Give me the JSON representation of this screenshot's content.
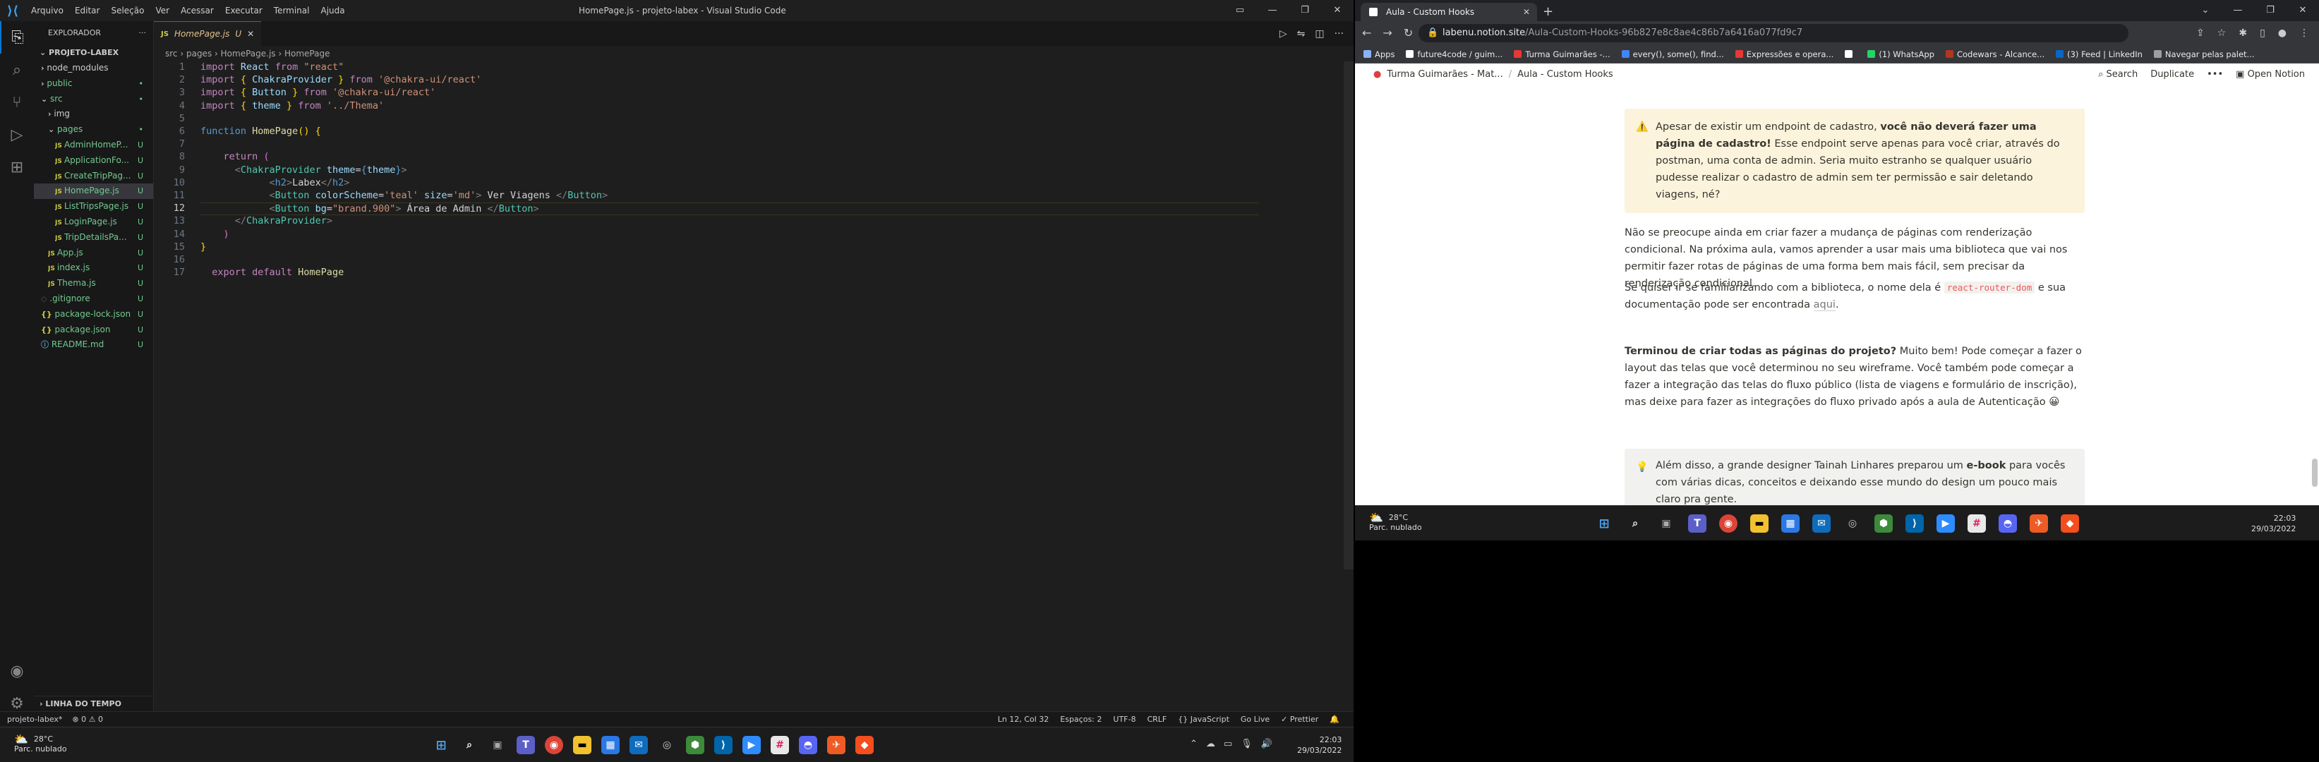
{
  "vscode": {
    "window_title": "HomePage.js - projeto-labex - Visual Studio Code",
    "menu": [
      "Arquivo",
      "Editar",
      "Seleção",
      "Ver",
      "Acessar",
      "Executar",
      "Terminal",
      "Ajuda"
    ],
    "explorer_title": "EXPLORADOR",
    "project": "PROJETO-LABEX",
    "tree": [
      {
        "name": "node_modules",
        "indent": 1,
        "kind": "folder",
        "badge": "",
        "color": "#cccccc"
      },
      {
        "name": "public",
        "indent": 1,
        "kind": "folder",
        "badge": "•",
        "color": "#73c991"
      },
      {
        "name": "src",
        "indent": 1,
        "kind": "folder-open",
        "badge": "•",
        "color": "#73c991"
      },
      {
        "name": "img",
        "indent": 2,
        "kind": "folder",
        "badge": "",
        "color": "#cccccc"
      },
      {
        "name": "pages",
        "indent": 2,
        "kind": "folder-open",
        "badge": "•",
        "color": "#73c991"
      },
      {
        "name": "AdminHomeP...",
        "indent": 3,
        "kind": "js",
        "badge": "U",
        "color": "#73c991"
      },
      {
        "name": "ApplicationFo...",
        "indent": 3,
        "kind": "js",
        "badge": "U",
        "color": "#73c991"
      },
      {
        "name": "CreateTripPag...",
        "indent": 3,
        "kind": "js",
        "badge": "U",
        "color": "#73c991"
      },
      {
        "name": "HomePage.js",
        "indent": 3,
        "kind": "js",
        "badge": "U",
        "color": "#73c991",
        "selected": true
      },
      {
        "name": "ListTripsPage.js",
        "indent": 3,
        "kind": "js",
        "badge": "U",
        "color": "#73c991"
      },
      {
        "name": "LoginPage.js",
        "indent": 3,
        "kind": "js",
        "badge": "U",
        "color": "#73c991"
      },
      {
        "name": "TripDetailsPa...",
        "indent": 3,
        "kind": "js",
        "badge": "U",
        "color": "#73c991"
      },
      {
        "name": "App.js",
        "indent": 2,
        "kind": "js",
        "badge": "U",
        "color": "#73c991"
      },
      {
        "name": "index.js",
        "indent": 2,
        "kind": "js",
        "badge": "U",
        "color": "#73c991"
      },
      {
        "name": "Thema.js",
        "indent": 2,
        "kind": "js",
        "badge": "U",
        "color": "#73c991"
      },
      {
        "name": ".gitignore",
        "indent": 1,
        "kind": "git",
        "badge": "U",
        "color": "#73c991"
      },
      {
        "name": "package-lock.json",
        "indent": 1,
        "kind": "json",
        "badge": "U",
        "color": "#73c991"
      },
      {
        "name": "package.json",
        "indent": 1,
        "kind": "json",
        "badge": "U",
        "color": "#73c991"
      },
      {
        "name": "README.md",
        "indent": 1,
        "kind": "md",
        "badge": "U",
        "color": "#73c991"
      }
    ],
    "timeline": "LINHA DO TEMPO",
    "tab_label": "HomePage.js",
    "tab_status": "U",
    "breadcrumb": [
      "src",
      "pages",
      "HomePage.js",
      "HomePage"
    ],
    "code_lines": [
      [
        [
          "kw",
          "import "
        ],
        [
          "vr",
          "React "
        ],
        [
          "kw",
          "from "
        ],
        [
          "str",
          "\"react\""
        ]
      ],
      [
        [
          "kw",
          "import "
        ],
        [
          "br",
          "{ "
        ],
        [
          "vr",
          "ChakraProvider "
        ],
        [
          "br",
          "} "
        ],
        [
          "kw",
          "from "
        ],
        [
          "str",
          "'@chakra-ui/react'"
        ]
      ],
      [
        [
          "kw",
          "import "
        ],
        [
          "br",
          "{ "
        ],
        [
          "vr",
          "Button "
        ],
        [
          "br",
          "} "
        ],
        [
          "kw",
          "from "
        ],
        [
          "str",
          "'@chakra-ui/react'"
        ]
      ],
      [
        [
          "kw",
          "import "
        ],
        [
          "br",
          "{ "
        ],
        [
          "vr",
          "theme "
        ],
        [
          "br",
          "} "
        ],
        [
          "kw",
          "from "
        ],
        [
          "str",
          "'../Thema'"
        ]
      ],
      [],
      [
        [
          "kw2",
          "function "
        ],
        [
          "fn",
          "HomePage"
        ],
        [
          "br",
          "() {"
        ]
      ],
      [],
      [
        [
          "kw",
          "    return "
        ],
        [
          "br2",
          "("
        ]
      ],
      [
        [
          "gr",
          "      <"
        ],
        [
          "tg",
          "ChakraProvider "
        ],
        [
          "vr",
          "theme"
        ],
        [
          "txt",
          "="
        ],
        [
          "kw2",
          "{"
        ],
        [
          "vr",
          "theme"
        ],
        [
          "kw2",
          "}"
        ],
        [
          "gr",
          ">"
        ]
      ],
      [
        [
          "gr",
          "            <"
        ],
        [
          "kw2",
          "h2"
        ],
        [
          "gr",
          ">"
        ],
        [
          "txt",
          "Labex"
        ],
        [
          "gr",
          "</"
        ],
        [
          "kw2",
          "h2"
        ],
        [
          "gr",
          ">"
        ]
      ],
      [
        [
          "gr",
          "            <"
        ],
        [
          "tg",
          "Button "
        ],
        [
          "vr",
          "colorScheme"
        ],
        [
          "txt",
          "="
        ],
        [
          "str",
          "'teal' "
        ],
        [
          "vr",
          "size"
        ],
        [
          "txt",
          "="
        ],
        [
          "str",
          "'md'"
        ],
        [
          "gr",
          "> "
        ],
        [
          "txt",
          "Ver Viagens "
        ],
        [
          "gr",
          "</"
        ],
        [
          "tg",
          "Button"
        ],
        [
          "gr",
          ">"
        ]
      ],
      [
        [
          "gr",
          "            <"
        ],
        [
          "tg",
          "Button "
        ],
        [
          "vr",
          "bg"
        ],
        [
          "txt",
          "="
        ],
        [
          "str",
          "\"brand.900\""
        ],
        [
          "gr",
          "> "
        ],
        [
          "txt",
          "Área de Admin "
        ],
        [
          "gr",
          "</"
        ],
        [
          "tg",
          "Button"
        ],
        [
          "gr",
          ">"
        ]
      ],
      [
        [
          "gr",
          "      </"
        ],
        [
          "tg",
          "ChakraProvider"
        ],
        [
          "gr",
          ">"
        ]
      ],
      [
        [
          "br2",
          "    )"
        ]
      ],
      [
        [
          "br",
          "}"
        ]
      ],
      [],
      [
        [
          "kw",
          "  export default "
        ],
        [
          "fn",
          "HomePage"
        ]
      ]
    ],
    "status_left": [
      "projeto-labex*",
      "⊗ 0 ⚠ 0"
    ],
    "status_right": [
      "Ln 12, Col 32",
      "Espaços: 2",
      "UTF-8",
      "CRLF",
      "{} JavaScript",
      "Go Live",
      "✓ Prettier"
    ],
    "taskbar": {
      "temp": "28°C",
      "weather": "Parc. nublado",
      "time": "22:03",
      "date": "29/03/2022"
    }
  },
  "chrome": {
    "tab_title": "Aula - Custom Hooks",
    "url_host": "labenu.notion.site",
    "url_path": "/Aula-Custom-Hooks-96b827e8c8ae4c86b7a6416a077fd9c7",
    "bookmarks": [
      {
        "label": "Apps",
        "color": "#8ab4f8"
      },
      {
        "label": "future4code / guim...",
        "color": "#ffffff"
      },
      {
        "label": "Turma Guimarães -...",
        "color": "#e53935"
      },
      {
        "label": "every(), some(), find...",
        "color": "#4285f4"
      },
      {
        "label": "Expressões e opera...",
        "color": "#e53935"
      },
      {
        "label": "",
        "color": "#ffffff"
      },
      {
        "label": "(1) WhatsApp",
        "color": "#25d366"
      },
      {
        "label": "Codewars - Alcance...",
        "color": "#b1361e"
      },
      {
        "label": "(3) Feed | LinkedIn",
        "color": "#0a66c2"
      },
      {
        "label": "Navegar pelas palet...",
        "color": "#9e9e9e"
      }
    ],
    "notion_breadcrumb": [
      "Turma Guimarães - Mat...",
      "/",
      "Aula - Custom Hooks"
    ],
    "notion_actions": [
      "Search",
      "Duplicate",
      "•••",
      "Open Notion"
    ],
    "callout1": {
      "icon": "⚠️",
      "pre": "Apesar de existir um endpoint de cadastro, ",
      "bold": "você não deverá fazer uma página de cadastro!",
      "post": " Esse endpoint serve apenas para você criar, através do postman, uma conta de admin. Seria muito estranho se qualquer usuário pudesse realizar o cadastro de admin sem ter permissão e sair deletando viagens, né?"
    },
    "para1": "Não se preocupe ainda em criar fazer a mudança de páginas com renderização condicional. Na próxima aula, vamos aprender a usar mais uma biblioteca que vai nos permitir fazer rotas de páginas de uma forma bem mais fácil, sem precisar da renderização condicional.",
    "para2": {
      "pre": "Se quiser ir se familiarizando com a biblioteca, o nome dela é ",
      "code": "react-router-dom",
      "mid": " e sua documentação pode ser encontrada ",
      "link": "aqui",
      "post": "."
    },
    "para3": {
      "bold": "Terminou de criar todas as páginas do projeto?",
      "rest": " Muito bem! Pode começar a fazer o layout das telas que você determinou no seu wireframe. Você também pode começar a fazer a integração das telas do fluxo público (lista de viagens e formulário de inscrição), mas deixe para fazer as integrações do fluxo privado após a aula de Autenticação 😀"
    },
    "callout2": {
      "icon": "💡",
      "pre": "Além disso, a grande designer Tainah Linhares preparou um ",
      "bold": "e-book",
      "post": " para vocês com várias dicas, conceitos e deixando esse mundo do design um pouco mais claro pra gente."
    },
    "taskbar": {
      "temp": "28°C",
      "weather": "Parc. nublado",
      "time": "22:03",
      "date": "29/03/2022"
    }
  }
}
